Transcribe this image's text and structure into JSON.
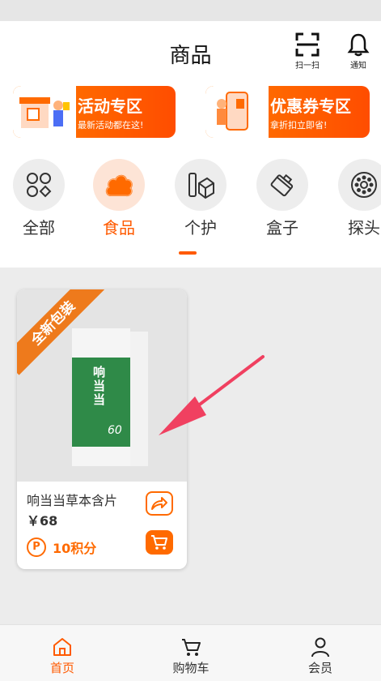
{
  "header": {
    "title": "商品",
    "scan_label": "扫一扫",
    "notify_label": "通知"
  },
  "promos": [
    {
      "title": "活动专区",
      "subtitle": "最新活动都在这!"
    },
    {
      "title": "优惠券专区",
      "subtitle": "拿折扣立即省!"
    }
  ],
  "categories": [
    {
      "label": "全部",
      "icon": "grid-shapes-icon"
    },
    {
      "label": "食品",
      "icon": "cloud-icon",
      "active": true
    },
    {
      "label": "个护",
      "icon": "bottle-icon"
    },
    {
      "label": "盒子",
      "icon": "box-icon"
    },
    {
      "label": "探头",
      "icon": "probe-icon"
    }
  ],
  "product": {
    "ribbon": "全新包装",
    "package_text": "响当当",
    "package_count": "60",
    "name": "响当当草本含片",
    "price": "￥68",
    "points_icon": "P",
    "points": "10积分"
  },
  "nav": [
    {
      "label": "首页",
      "icon": "home-icon",
      "active": true
    },
    {
      "label": "购物车",
      "icon": "cart-icon"
    },
    {
      "label": "会员",
      "icon": "user-icon"
    }
  ],
  "colors": {
    "accent": "#ff5a00",
    "arrow": "#f04060"
  }
}
